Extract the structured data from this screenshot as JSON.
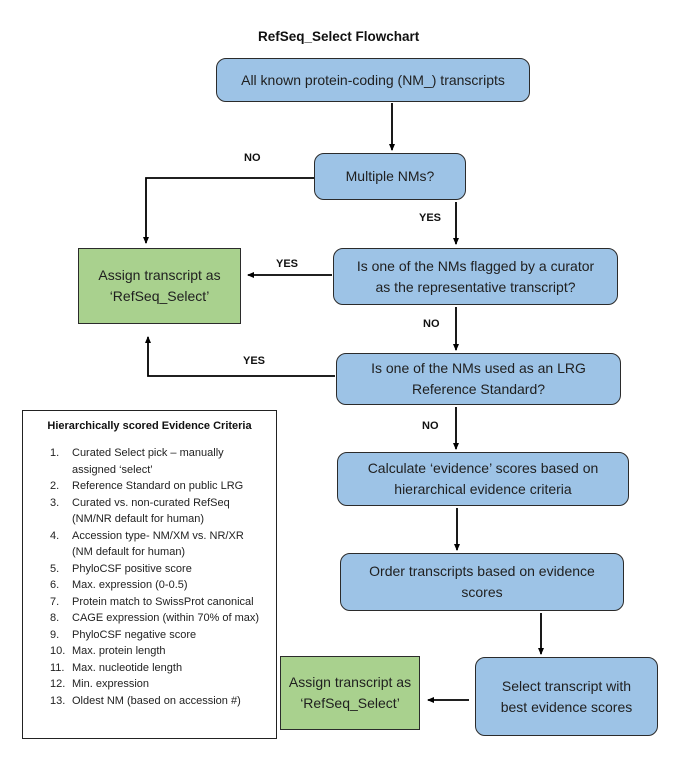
{
  "title": "RefSeq_Select Flowchart",
  "nodes": {
    "start": "All known protein-coding (NM_) transcripts",
    "multiple": "Multiple NMs?",
    "flagged": "Is one of the NMs flagged by a curator as the representative transcript?",
    "lrg": "Is one of the NMs used as an LRG Reference Standard?",
    "calculate": "Calculate ‘evidence’ scores based on hierarchical evidence criteria",
    "order": "Order transcripts based on evidence scores",
    "select_best": "Select transcript with best evidence scores",
    "assign_top": "Assign transcript as ‘RefSeq_Select’",
    "assign_bottom": "Assign transcript as ‘RefSeq_Select’"
  },
  "edge_labels": {
    "multiple_no": "NO",
    "multiple_yes": "YES",
    "flagged_yes": "YES",
    "flagged_no": "NO",
    "lrg_yes": "YES",
    "lrg_no": "NO"
  },
  "criteria": {
    "heading": "Hierarchically scored Evidence Criteria",
    "items": [
      {
        "n": "1.",
        "text": "Curated Select pick – manually assigned ‘select’"
      },
      {
        "n": "2.",
        "text": "Reference Standard on public LRG"
      },
      {
        "n": "3.",
        "text": "Curated vs. non-curated RefSeq (NM/NR default for human)"
      },
      {
        "n": "4.",
        "text": "Accession type- NM/XM vs. NR/XR (NM default for human)"
      },
      {
        "n": "5.",
        "text": "PhyloCSF positive score"
      },
      {
        "n": "6.",
        "text": "Max. expression (0-0.5)"
      },
      {
        "n": "7.",
        "text": "Protein match to SwissProt canonical"
      },
      {
        "n": "8.",
        "text": "CAGE expression (within 70% of max)"
      },
      {
        "n": "9.",
        "text": "PhyloCSF negative score"
      },
      {
        "n": "10.",
        "text": "Max. protein length"
      },
      {
        "n": "11.",
        "text": "Max. nucleotide length"
      },
      {
        "n": "12.",
        "text": "Min. expression"
      },
      {
        "n": "13.",
        "text": "Oldest NM (based on accession #)"
      }
    ]
  },
  "colors": {
    "decision_fill": "#9dc3e6",
    "result_fill": "#a9d18e",
    "line": "#000000"
  }
}
